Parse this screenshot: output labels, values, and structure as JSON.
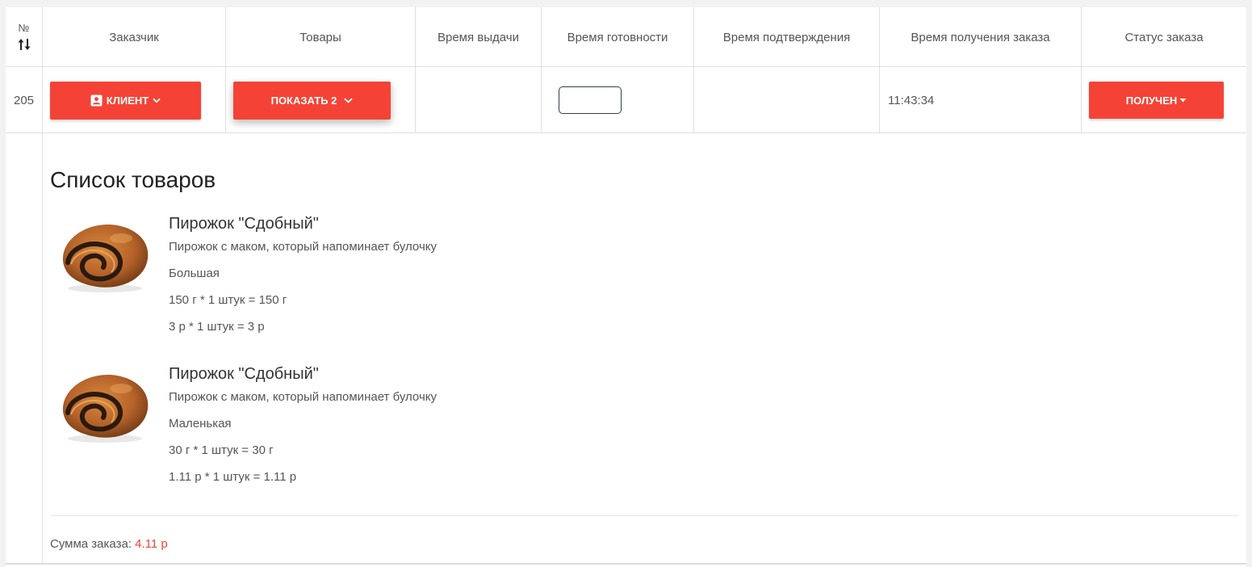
{
  "table": {
    "headers": {
      "number": "№",
      "customer": "Заказчик",
      "goods": "Товары",
      "issue_time": "Время выдачи",
      "ready_time": "Время готовности",
      "confirm_time": "Время подтверждения",
      "receive_time": "Время получения заказа",
      "status": "Статус заказа"
    },
    "row": {
      "number": "205",
      "customer_button": "Клиент",
      "goods_button": "Показать 2",
      "issue_time": "",
      "ready_time_value": "",
      "confirm_time": "",
      "receive_time": "11:43:34",
      "status_button": "Получен"
    }
  },
  "panel": {
    "title": "Список товаров",
    "products": [
      {
        "name": "Пирожок \"Сдобный\"",
        "description": "Пирожок с маком, который напоминает булочку",
        "size": "Большая",
        "weight": "150 г * 1 штук = 150 г",
        "price": "3 р * 1 штук = 3 р",
        "image": "poppy-seed-roll"
      },
      {
        "name": "Пирожок \"Сдобный\"",
        "description": "Пирожок с маком, который напоминает булочку",
        "size": "Маленькая",
        "weight": "30 г * 1 штук = 30 г",
        "price": "1.11 р * 1 штук = 1.11 р",
        "image": "poppy-seed-roll"
      }
    ],
    "sum_label": "Сумма заказа: ",
    "sum_value": "4.11 р"
  },
  "colors": {
    "accent": "#f44336",
    "text": "#555555",
    "title": "#222222",
    "border": "#e0e0e0"
  },
  "icons": {
    "sort": "sort-arrows-icon",
    "client": "contact-card-icon",
    "dropdown": "chevron-down-icon",
    "caret": "caret-down-icon"
  }
}
